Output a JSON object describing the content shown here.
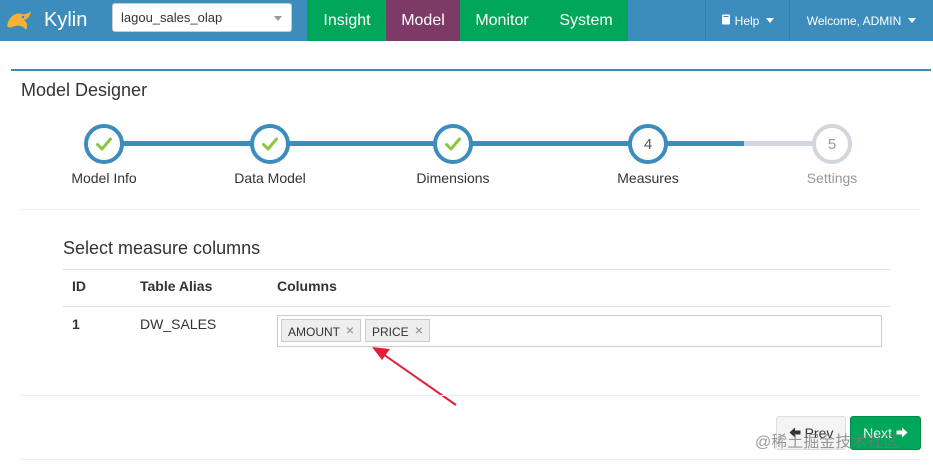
{
  "app": {
    "brand": "Kylin"
  },
  "project": {
    "selected": "lagou_sales_olap"
  },
  "nav": {
    "tabs": [
      {
        "label": "Insight",
        "active": false
      },
      {
        "label": "Model",
        "active": true
      },
      {
        "label": "Monitor",
        "active": false
      },
      {
        "label": "System",
        "active": false
      }
    ],
    "help": "Help",
    "welcome": "Welcome, ADMIN"
  },
  "panel": {
    "title": "Model Designer"
  },
  "wizard": {
    "steps": [
      {
        "label": "Model Info",
        "state": "done",
        "number": "1"
      },
      {
        "label": "Data Model",
        "state": "done",
        "number": "2"
      },
      {
        "label": "Dimensions",
        "state": "done",
        "number": "3"
      },
      {
        "label": "Measures",
        "state": "current",
        "number": "4"
      },
      {
        "label": "Settings",
        "state": "pending",
        "number": "5"
      }
    ]
  },
  "measures": {
    "section_title": "Select measure columns",
    "headers": {
      "id": "ID",
      "alias": "Table Alias",
      "columns": "Columns"
    },
    "rows": [
      {
        "id": "1",
        "alias": "DW_SALES",
        "columns": [
          "AMOUNT",
          "PRICE"
        ]
      }
    ]
  },
  "buttons": {
    "prev": "Prev",
    "next": "Next"
  },
  "watermark": "@稀土掘金技术社区",
  "colors": {
    "primary": "#3c8dbc",
    "success": "#00a65a",
    "active_tab": "#7d3a67",
    "arrow": "#e0203a"
  }
}
